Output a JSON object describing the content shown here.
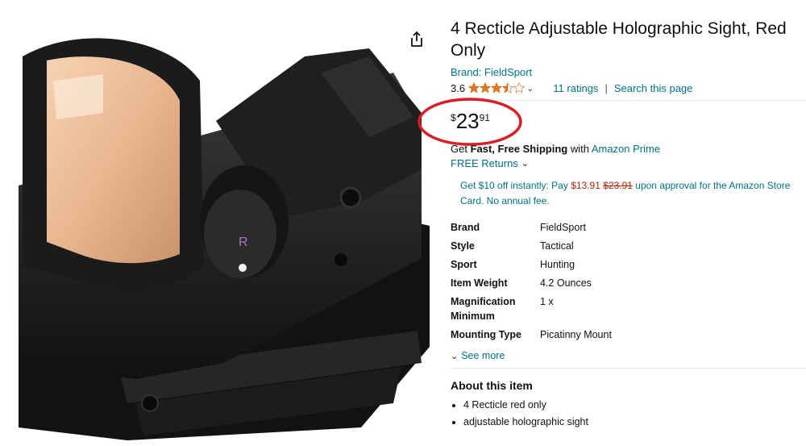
{
  "product": {
    "title": "4 Recticle Adjustable Holographic Sight, Red Only",
    "brand_link": "Brand: FieldSport",
    "rating_value": "3.6",
    "rating_fraction": 0.72,
    "ratings_count": "11 ratings",
    "search_link": "Search this page",
    "rating_separator": "|"
  },
  "price": {
    "symbol": "$",
    "whole": "23",
    "fraction": "91"
  },
  "shipping": {
    "prefix": "Get ",
    "bold": "Fast, Free Shipping",
    "middle": " with ",
    "prime_link": "Amazon Prime",
    "returns": "FREE Returns"
  },
  "promo": {
    "part1": "Get $10 off instantly: Pay ",
    "new_price": "$13.91",
    "space": " ",
    "old_price": "$23.91",
    "part2": " upon approval for the Amazon Store Card. No annual fee."
  },
  "specs": [
    {
      "key": "Brand",
      "value": "FieldSport"
    },
    {
      "key": "Style",
      "value": "Tactical"
    },
    {
      "key": "Sport",
      "value": "Hunting"
    },
    {
      "key": "Item Weight",
      "value": "4.2 Ounces"
    },
    {
      "key": "Magnification Minimum",
      "value": "1 x"
    },
    {
      "key": "Mounting Type",
      "value": "Picatinny Mount"
    }
  ],
  "see_more": "See more",
  "about": {
    "heading": "About this item",
    "items": [
      "4 Recticle red only",
      "adjustable holographic sight"
    ]
  },
  "icons": {
    "share": "share-icon",
    "star": "star-icon",
    "chevron": "chevron-down-icon"
  },
  "colors": {
    "link": "#007185",
    "price_red": "#b12704",
    "star": "#de7921",
    "highlight_circle": "#d91f26"
  }
}
